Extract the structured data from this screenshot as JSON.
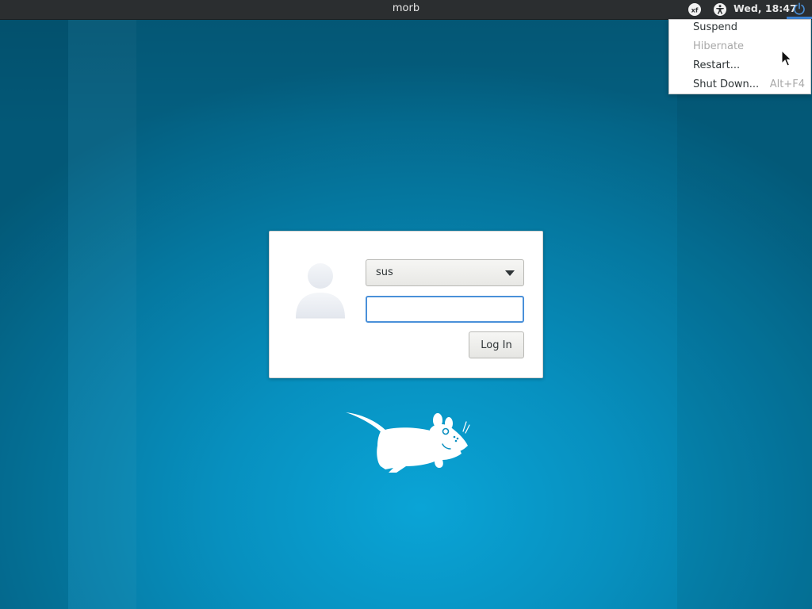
{
  "panel": {
    "hostname": "morb",
    "clock": "Wed, 18:47",
    "indicators": {
      "keyboard": "xf",
      "accessibility_icon": "accessibility-icon",
      "power_icon": "power-icon"
    }
  },
  "power_menu": {
    "items": [
      {
        "label": "Suspend",
        "enabled": true,
        "accel": ""
      },
      {
        "label": "Hibernate",
        "enabled": false,
        "accel": ""
      },
      {
        "label": "Restart...",
        "enabled": true,
        "accel": ""
      },
      {
        "label": "Shut Down...",
        "enabled": true,
        "accel": "Alt+F4"
      }
    ]
  },
  "login": {
    "avatar_icon": "user-avatar-icon",
    "user_selected": "sus",
    "password_value": "",
    "login_button": "Log In"
  },
  "background": {
    "logo_icon": "xfce-mouse-logo",
    "colors": {
      "accent": "#4a90d9",
      "panel": "#2b2e30",
      "background_center": "#0aa4d6",
      "background_edge": "#045f80"
    }
  }
}
